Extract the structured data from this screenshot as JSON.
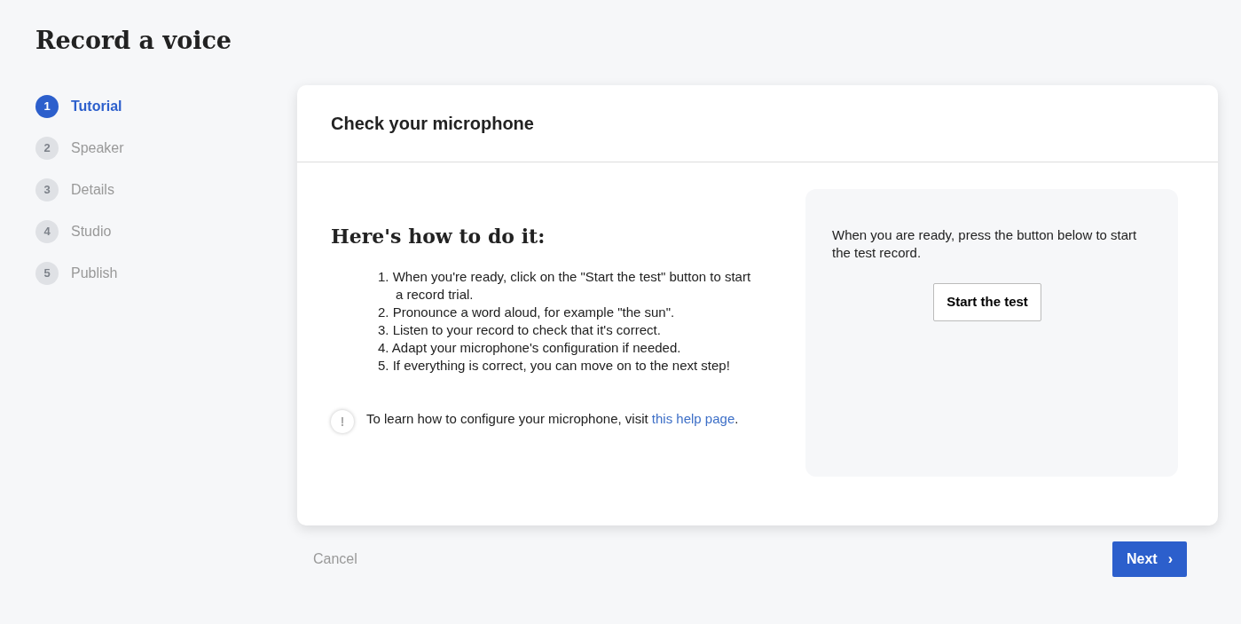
{
  "title": "Record a voice",
  "steps": [
    {
      "number": "1",
      "label": "Tutorial",
      "selected": true
    },
    {
      "number": "2",
      "label": "Speaker",
      "selected": false
    },
    {
      "number": "3",
      "label": "Details",
      "selected": false
    },
    {
      "number": "4",
      "label": "Studio",
      "selected": false
    },
    {
      "number": "5",
      "label": "Publish",
      "selected": false
    }
  ],
  "card": {
    "title": "Check your microphone",
    "heading": "Here's how to do it:",
    "instructions": [
      {
        "number": "1.",
        "text": "When you're ready, click on the \"Start the test\" button to start a record trial."
      },
      {
        "number": "2.",
        "text": "Pronounce a word aloud, for example \"the sun\"."
      },
      {
        "number": "3.",
        "text": "Listen to your record to check that it's correct."
      },
      {
        "number": "4.",
        "text": "Adapt your microphone's configuration if needed."
      },
      {
        "number": "5.",
        "text": "If everything is correct, you can move on to the next step!"
      }
    ],
    "note": {
      "icon": "!",
      "text": "To learn how to configure your microphone, visit ",
      "link": "this help page",
      "end": "."
    },
    "panel": {
      "text": "When you are ready, press the button below to start the test record.",
      "button": "Start the test"
    }
  },
  "footer": {
    "cancel": "Cancel",
    "next": "Next",
    "next_icon": "›"
  }
}
